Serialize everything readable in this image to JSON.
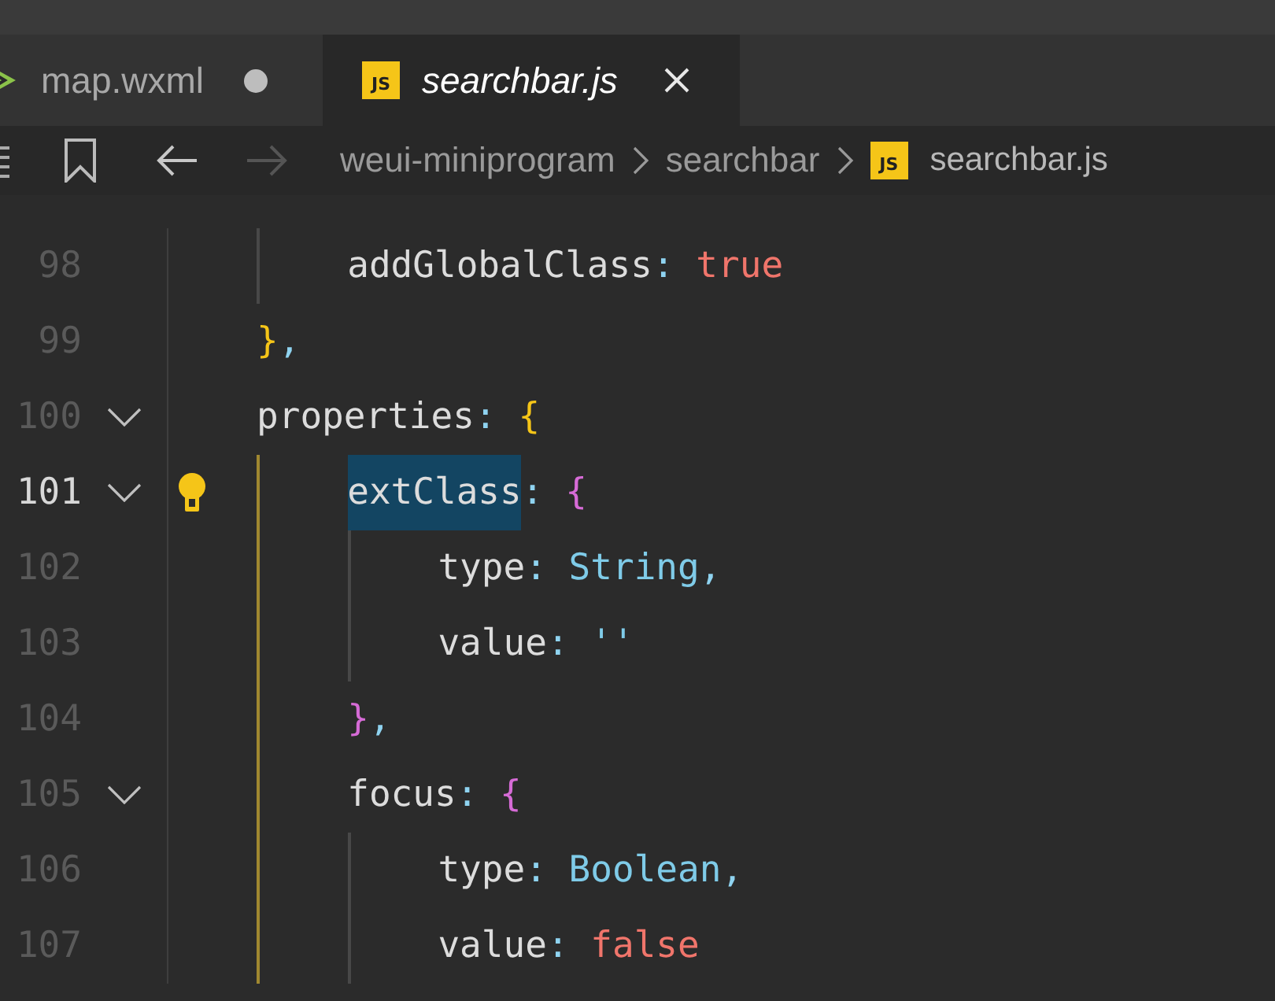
{
  "tabs": [
    {
      "label": "map.wxml",
      "kind": "markup",
      "selected": false,
      "modified": true
    },
    {
      "label": "searchbar.js",
      "kind": "script",
      "icon_text": "JS",
      "selected": true,
      "modified": false
    }
  ],
  "breadcrumb": {
    "back_disabled": false,
    "forward_disabled": true,
    "items": [
      {
        "label": "weui-miniprogram",
        "kind": "folder"
      },
      {
        "label": "searchbar",
        "kind": "folder"
      },
      {
        "label": "searchbar.js",
        "kind": "script",
        "icon_text": "JS"
      }
    ]
  },
  "lines": [
    {
      "number": "98",
      "foldable": false,
      "current": false,
      "lightbulb": false,
      "active_block": false,
      "tokens": [
        {
          "kind": "key",
          "text": "    addGlobalClass"
        },
        {
          "kind": "punct",
          "text": ":"
        },
        {
          "kind": "literal",
          "text": " true"
        }
      ]
    },
    {
      "number": "99",
      "foldable": false,
      "current": false,
      "lightbulb": false,
      "tokens": [
        {
          "kind": "brace1",
          "text": "}"
        },
        {
          "kind": "punct",
          "text": ","
        }
      ]
    },
    {
      "number": "100",
      "foldable": true,
      "current": false,
      "lightbulb": false,
      "tokens": [
        {
          "kind": "key",
          "text": "properties"
        },
        {
          "kind": "punct",
          "text": ":"
        },
        {
          "kind": "brace1",
          "text": " {"
        }
      ]
    },
    {
      "number": "101",
      "foldable": true,
      "current": true,
      "lightbulb": true,
      "active_block": true,
      "tokens": [
        {
          "kind": "key",
          "text": "    extClass",
          "selected": true
        },
        {
          "kind": "punct",
          "text": ":"
        },
        {
          "kind": "brace2",
          "text": " {"
        }
      ]
    },
    {
      "number": "102",
      "foldable": false,
      "current": false,
      "lightbulb": false,
      "active_block": true,
      "tokens": [
        {
          "kind": "key",
          "text": "        type"
        },
        {
          "kind": "punct",
          "text": ":"
        },
        {
          "kind": "type",
          "text": " String"
        },
        {
          "kind": "punct",
          "text": ","
        }
      ]
    },
    {
      "number": "103",
      "foldable": false,
      "current": false,
      "lightbulb": false,
      "active_block": true,
      "tokens": [
        {
          "kind": "key",
          "text": "        value"
        },
        {
          "kind": "punct",
          "text": ":"
        },
        {
          "kind": "string",
          "text": " ''"
        }
      ]
    },
    {
      "number": "104",
      "foldable": false,
      "current": false,
      "lightbulb": false,
      "active_block": true,
      "tokens": [
        {
          "kind": "brace2",
          "text": "    }"
        },
        {
          "kind": "punct",
          "text": ","
        }
      ]
    },
    {
      "number": "105",
      "foldable": true,
      "current": false,
      "lightbulb": false,
      "active_block": true,
      "tokens": [
        {
          "kind": "key",
          "text": "    focus"
        },
        {
          "kind": "punct",
          "text": ":"
        },
        {
          "kind": "brace2",
          "text": " {"
        }
      ]
    },
    {
      "number": "106",
      "foldable": false,
      "current": false,
      "lightbulb": false,
      "active_block": true,
      "tokens": [
        {
          "kind": "key",
          "text": "        type"
        },
        {
          "kind": "punct",
          "text": ":"
        },
        {
          "kind": "type",
          "text": " Boolean"
        },
        {
          "kind": "punct",
          "text": ","
        }
      ]
    },
    {
      "number": "107",
      "foldable": false,
      "current": false,
      "lightbulb": false,
      "active_block": true,
      "tokens": [
        {
          "kind": "key",
          "text": "        value"
        },
        {
          "kind": "punct",
          "text": ":"
        },
        {
          "kind": "literal",
          "text": " false"
        }
      ]
    }
  ]
}
